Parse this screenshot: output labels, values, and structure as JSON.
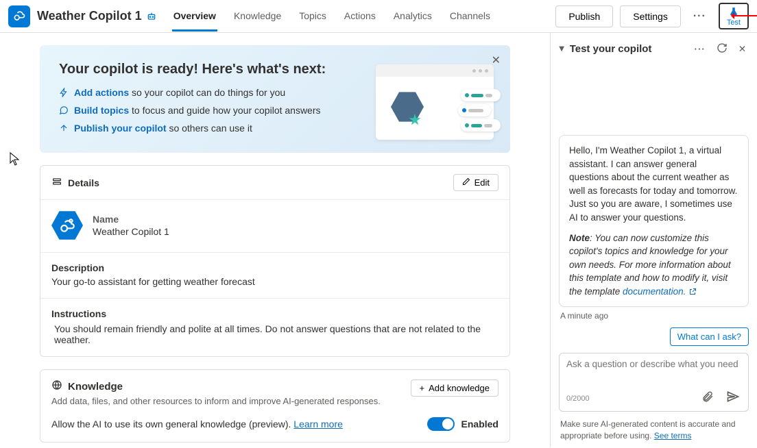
{
  "header": {
    "app_name": "Weather Copilot 1",
    "tabs": [
      "Overview",
      "Knowledge",
      "Topics",
      "Actions",
      "Analytics",
      "Channels"
    ],
    "active_tab": 0,
    "publish_btn": "Publish",
    "settings_btn": "Settings",
    "test_btn": "Test"
  },
  "ready": {
    "heading": "Your copilot is ready! Here's what's next:",
    "items": [
      {
        "link": "Add actions",
        "rest": " so your copilot can do things for you"
      },
      {
        "link": "Build topics",
        "rest": " to focus and guide how your copilot answers"
      },
      {
        "link": "Publish your copilot",
        "rest": " so others can use it"
      }
    ]
  },
  "details": {
    "section_title": "Details",
    "edit_label": "Edit",
    "name_label": "Name",
    "name_value": "Weather Copilot 1",
    "desc_label": "Description",
    "desc_value": "Your go-to assistant for getting weather forecast",
    "instr_label": "Instructions",
    "instr_value": "You should remain friendly and polite at all times. Do not answer questions that are not related to the weather."
  },
  "knowledge": {
    "section_title": "Knowledge",
    "subtitle": "Add data, files, and other resources to inform and improve AI-generated responses.",
    "add_btn": "Add knowledge",
    "toggle_text": "Allow the AI to use its own general knowledge (preview). ",
    "learn_more": "Learn more",
    "toggle_state": "Enabled"
  },
  "test_panel": {
    "title": "Test your copilot",
    "greeting": "Hello, I'm Weather Copilot 1, a virtual assistant. I can answer general questions about the current weather as well as forecasts for today and tomorrow. Just so you are aware, I sometimes use AI to answer your questions.",
    "note_label": "Note",
    "note_text": ": You can now customize this copilot's topics and knowledge for your own needs. For more information about this template and how to modify it, visit the template ",
    "note_link": "documentation.",
    "timestamp": "A minute ago",
    "suggestion_chip": "What can I ask?",
    "input_placeholder": "Ask a question or describe what you need",
    "char_count": "0/2000",
    "footer_text": "Make sure AI-generated content is accurate and appropriate before using. ",
    "footer_link": "See terms"
  }
}
